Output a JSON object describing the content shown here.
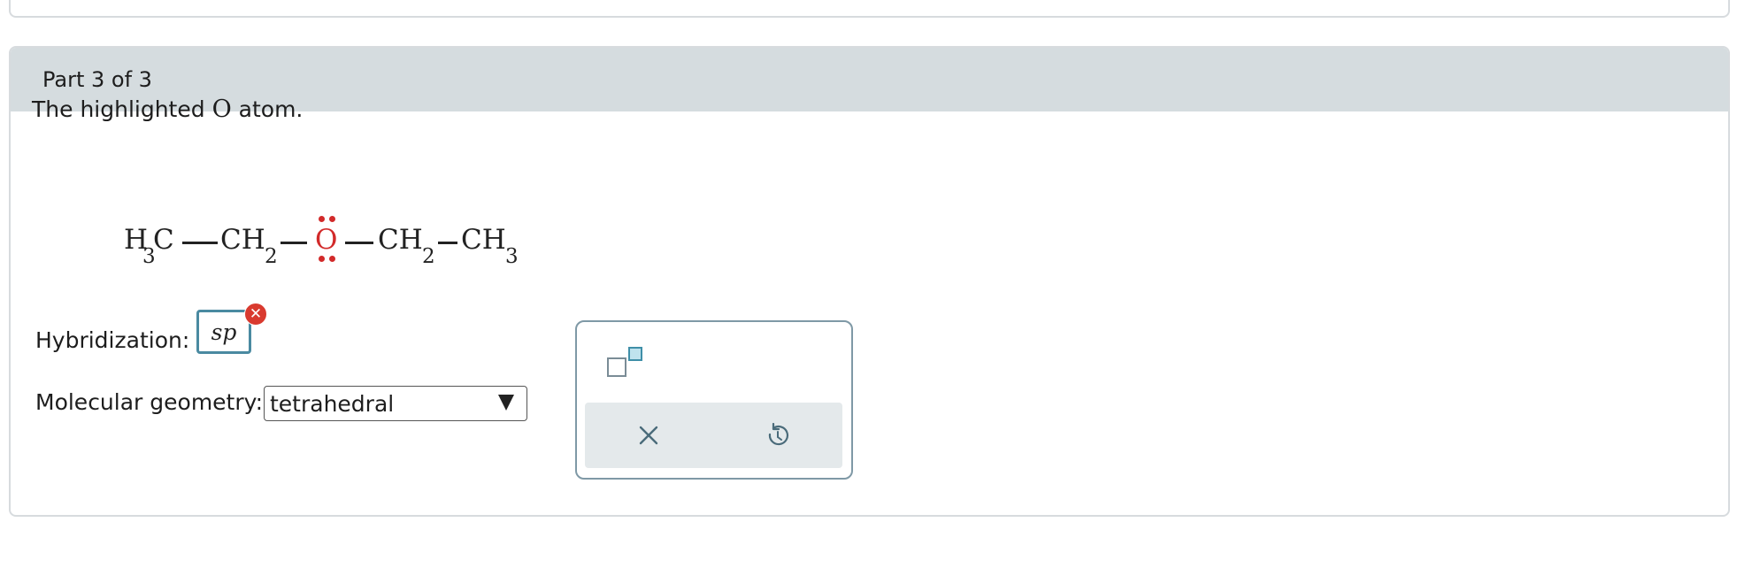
{
  "part": {
    "label": "Part 3 of 3"
  },
  "question": {
    "text_before": "The highlighted ",
    "atom": "O",
    "text_after": " atom."
  },
  "molecule": {
    "h3c_h": "H",
    "h3c_sub": "3",
    "h3c_c": "C",
    "ch2a_ch": "CH",
    "ch2a_sub": "2",
    "o": "O",
    "ch2b_ch": "CH",
    "ch2b_sub": "2",
    "ch3_ch": "CH",
    "ch3_sub": "3",
    "highlight_color": "#d22a2a"
  },
  "hybridization": {
    "label": "Hybridization:",
    "value": "sp",
    "status": "incorrect",
    "status_icon": "x-icon"
  },
  "geometry": {
    "label": "Molecular geometry:",
    "selected": "tetrahedral"
  },
  "palette": {
    "tools": [
      "superscript-icon"
    ],
    "actions": [
      "clear-icon",
      "undo-icon"
    ]
  },
  "colors": {
    "header_bg": "#d5dcdf",
    "accent": "#4a8aa1",
    "error": "#d93a2f"
  }
}
